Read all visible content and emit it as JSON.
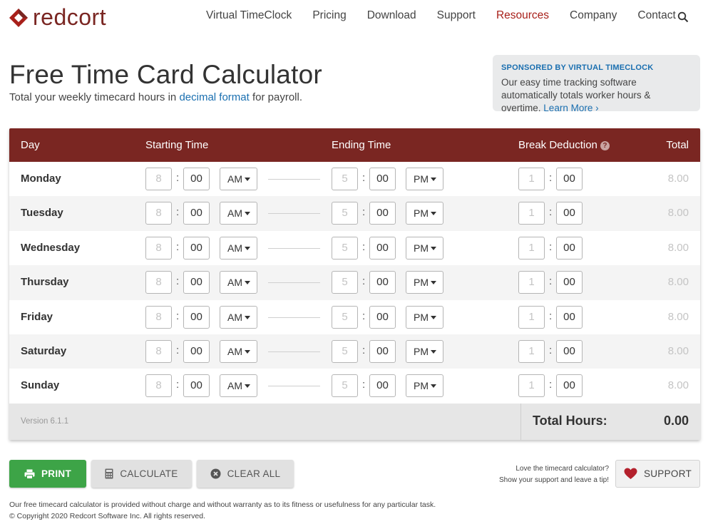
{
  "brand": {
    "name": "redcort",
    "color": "#7a2622",
    "logo_icon": "redcort-logo-icon"
  },
  "nav": {
    "items": [
      {
        "label": "Virtual TimeClock",
        "active": false
      },
      {
        "label": "Pricing",
        "active": false
      },
      {
        "label": "Download",
        "active": false
      },
      {
        "label": "Support",
        "active": false
      },
      {
        "label": "Resources",
        "active": true
      },
      {
        "label": "Company",
        "active": false
      },
      {
        "label": "Contact",
        "active": false
      }
    ],
    "search_icon": "search-icon"
  },
  "page": {
    "title": "Free Time Card Calculator",
    "subtitle_prefix": "Total your weekly timecard hours in",
    "subtitle_link": "decimal format",
    "subtitle_suffix": "for payroll."
  },
  "sponsor": {
    "tag": "SPONSORED BY VIRTUAL TIMECLOCK",
    "body": "Our easy time tracking software automatically totals worker hours & overtime.",
    "link": "Learn More"
  },
  "table": {
    "headers": {
      "day": "Day",
      "start": "Starting Time",
      "end": "Ending Time",
      "break": "Break Deduction",
      "break_help_icon": "help-icon",
      "total": "Total"
    },
    "rows": [
      {
        "day": "Monday",
        "start_hour": "8",
        "start_min": "00",
        "start_ampm": "AM",
        "end_hour": "5",
        "end_min": "00",
        "end_ampm": "PM",
        "break_hour": "1",
        "break_min": "00",
        "total": "8.00"
      },
      {
        "day": "Tuesday",
        "start_hour": "8",
        "start_min": "00",
        "start_ampm": "AM",
        "end_hour": "5",
        "end_min": "00",
        "end_ampm": "PM",
        "break_hour": "1",
        "break_min": "00",
        "total": "8.00"
      },
      {
        "day": "Wednesday",
        "start_hour": "8",
        "start_min": "00",
        "start_ampm": "AM",
        "end_hour": "5",
        "end_min": "00",
        "end_ampm": "PM",
        "break_hour": "1",
        "break_min": "00",
        "total": "8.00"
      },
      {
        "day": "Thursday",
        "start_hour": "8",
        "start_min": "00",
        "start_ampm": "AM",
        "end_hour": "5",
        "end_min": "00",
        "end_ampm": "PM",
        "break_hour": "1",
        "break_min": "00",
        "total": "8.00"
      },
      {
        "day": "Friday",
        "start_hour": "8",
        "start_min": "00",
        "start_ampm": "AM",
        "end_hour": "5",
        "end_min": "00",
        "end_ampm": "PM",
        "break_hour": "1",
        "break_min": "00",
        "total": "8.00"
      },
      {
        "day": "Saturday",
        "start_hour": "8",
        "start_min": "00",
        "start_ampm": "AM",
        "end_hour": "5",
        "end_min": "00",
        "end_ampm": "PM",
        "break_hour": "1",
        "break_min": "00",
        "total": "8.00"
      },
      {
        "day": "Sunday",
        "start_hour": "8",
        "start_min": "00",
        "start_ampm": "AM",
        "end_hour": "5",
        "end_min": "00",
        "end_ampm": "PM",
        "break_hour": "1",
        "break_min": "00",
        "total": "8.00"
      }
    ],
    "footer": {
      "version": "Version 6.1.1",
      "total_label": "Total Hours:",
      "total_value": "0.00"
    }
  },
  "actions": {
    "print": "PRINT",
    "calculate": "CALCULATE",
    "clear_all": "CLEAR ALL",
    "print_color": "#3da447"
  },
  "support": {
    "line1": "Love the timecard calculator?",
    "line2": "Show your support and leave a tip!",
    "button": "SUPPORT"
  },
  "footer": {
    "disclaimer": "Our free timecard calculator is provided without charge and without warranty as to its fitness or usefulness for any particular task.",
    "copyright": "© Copyright 2020 Redcort Software Inc. All rights reserved."
  }
}
